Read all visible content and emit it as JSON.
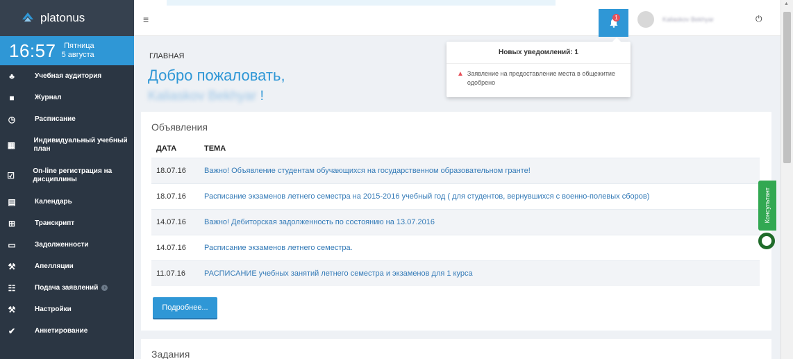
{
  "sidebar": {
    "logo_text": "platonus",
    "clock": {
      "time": "16:57",
      "weekday": "Пятница",
      "date": "5 августа"
    },
    "items": [
      {
        "label": "Учебная аудитория",
        "icon": "users-icon"
      },
      {
        "label": "Журнал",
        "icon": "book-icon"
      },
      {
        "label": "Расписание",
        "icon": "clock-icon"
      },
      {
        "label": "Индивидуальный учебный план",
        "icon": "grid-icon"
      },
      {
        "label": "On-line регистрация на дисциплины",
        "icon": "checkbox-icon"
      },
      {
        "label": "Календарь",
        "icon": "calendar-icon"
      },
      {
        "label": "Транскрипт",
        "icon": "table-icon"
      },
      {
        "label": "Задолженности",
        "icon": "inbox-icon"
      },
      {
        "label": "Апелляции",
        "icon": "gavel-icon"
      },
      {
        "label": "Подача заявлений",
        "icon": "file-icon"
      },
      {
        "label": "Настройки",
        "icon": "wrench-icon"
      },
      {
        "label": "Анкетирование",
        "icon": "check-circle-icon"
      }
    ]
  },
  "header": {
    "notification_count": "1",
    "user_name": "Kaliaskov Bekhyar"
  },
  "main": {
    "breadcrumb": "ГЛАВНАЯ",
    "welcome": "Добро пожаловать,",
    "welcome_name": "Kaliaskov Bekhyar",
    "welcome_suffix": " !",
    "announcements": {
      "title": "Объявления",
      "col_date": "ДАТА",
      "col_topic": "ТЕМА",
      "rows": [
        {
          "date": "18.07.16",
          "topic": "Важно! Объявление студентам обучающихся на государственном образовательном гранте!"
        },
        {
          "date": "18.07.16",
          "topic": "Расписание экзаменов летнего семестра на 2015-2016 учебный год ( для студентов, вернувшихся с военно-полевых сборов)"
        },
        {
          "date": "14.07.16",
          "topic": "Важно! Дебиторская задолженность по состоянию на 13.07.2016"
        },
        {
          "date": "14.07.16",
          "topic": "Расписание экзаменов летнего семестра."
        },
        {
          "date": "11.07.16",
          "topic": "РАСПИСАНИЕ учебных занятий летнего семестра и экзаменов для 1 курса"
        }
      ],
      "more_button": "Подробнее..."
    },
    "tasks": {
      "title": "Задания"
    }
  },
  "notifications": {
    "header": "Новых уведомлений: 1",
    "items": [
      {
        "text": "Заявление на предоставление места в общежитие одобрено"
      }
    ]
  },
  "consultant": {
    "label": "Консультант"
  },
  "colors": {
    "accent": "#2f97d6",
    "sidebar": "#2b3643",
    "badge": "#e7505a",
    "consultant": "#32a852"
  }
}
